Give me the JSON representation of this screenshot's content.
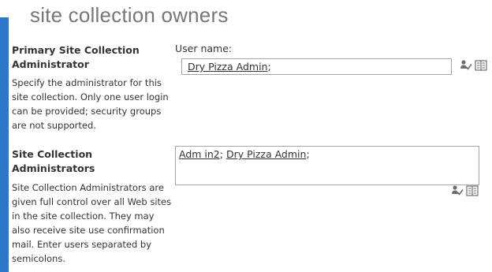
{
  "page": {
    "title": "site collection owners"
  },
  "primary": {
    "title": "Primary Site Collection Administrator",
    "description": "Specify the administrator for this site collection. Only one user login can be provided; security groups are not supported.",
    "field_label": "User name:",
    "entities": [
      "Dry Pizza Admin"
    ],
    "separator": ";"
  },
  "admins": {
    "title": "Site Collection Administrators",
    "description": "Site Collection Administrators are given full control over all Web sites in the site collection. They may also receive site use confirmation mail. Enter users separated by semicolons.",
    "entities": [
      "Adm in2",
      "Dry Pizza Admin"
    ],
    "separator": ";"
  },
  "icons": {
    "check_names": "check-names-icon",
    "browse": "address-book-icon"
  },
  "colors": {
    "accent_bar": "#2b78c8",
    "title_text": "#777777"
  }
}
